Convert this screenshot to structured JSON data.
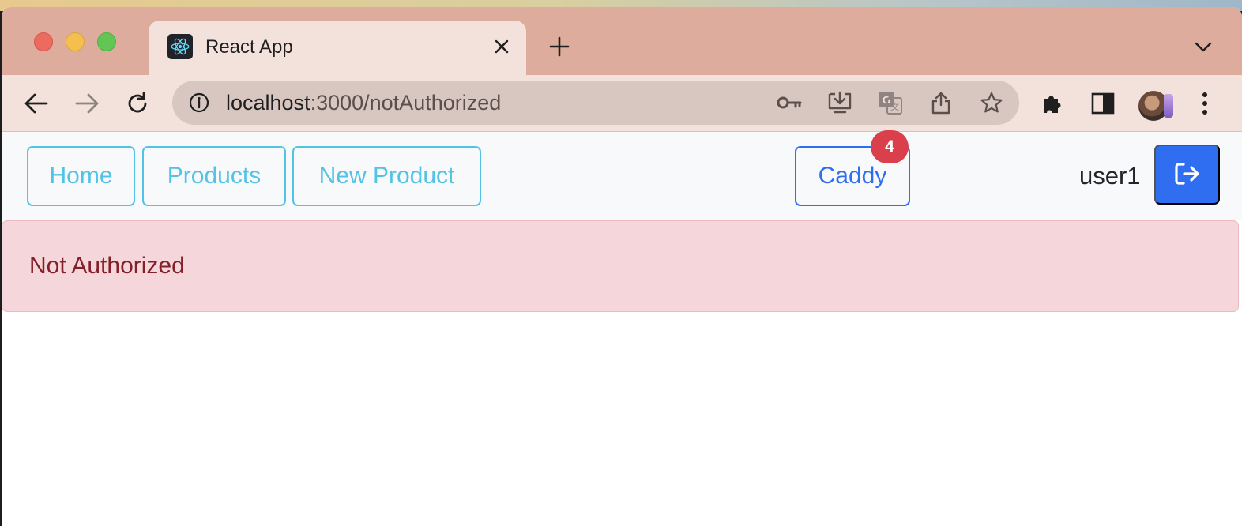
{
  "browser": {
    "tab": {
      "title": "React App",
      "favicon": "react-icon"
    },
    "omnibox": {
      "host": "localhost",
      "path": ":3000/notAuthorized"
    },
    "icons": {
      "back": "arrow-left-icon",
      "forward": "arrow-right-icon",
      "reload": "reload-icon",
      "info": "info-icon",
      "password": "key-icon",
      "install": "install-icon",
      "translate": "translate-icon",
      "share": "share-icon",
      "bookmark": "star-icon",
      "extensions": "puzzle-icon",
      "side_panel": "side-panel-icon",
      "menu": "kebab-menu-icon"
    }
  },
  "navbar": {
    "links": [
      {
        "label": "Home"
      },
      {
        "label": "Products"
      },
      {
        "label": "New Product"
      }
    ],
    "cart": {
      "label": "Caddy",
      "count": "4"
    },
    "user": {
      "name": "user1"
    },
    "logout_icon": "logout-icon"
  },
  "alert": {
    "message": "Not Authorized",
    "variant": "danger"
  },
  "colors": {
    "info": "#53c3e5",
    "primary": "#2f6ef0",
    "badge": "#d9404c",
    "alert_bg": "#f5d6da",
    "alert_text": "#842029"
  }
}
